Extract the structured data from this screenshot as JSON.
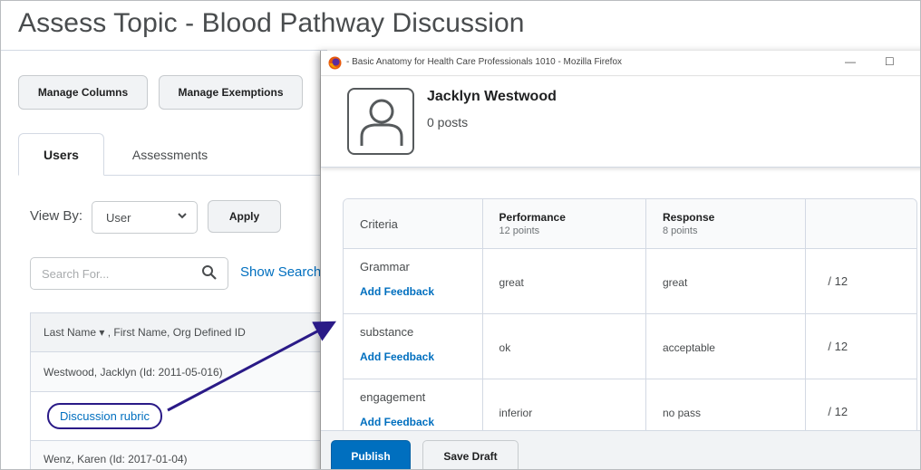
{
  "page": {
    "title": "Assess Topic - Blood Pathway Discussion"
  },
  "toolbar": {
    "manage_columns": "Manage Columns",
    "manage_exemptions": "Manage Exemptions"
  },
  "tabs": [
    {
      "label": "Users",
      "active": true
    },
    {
      "label": "Assessments",
      "active": false
    }
  ],
  "filter": {
    "view_by_label": "View By:",
    "view_by_value": "User",
    "apply_label": "Apply",
    "search_placeholder": "Search For...",
    "show_search_options": "Show Search"
  },
  "grid": {
    "header": "Last Name ▾ , First Name, Org Defined ID",
    "rows": [
      {
        "name": "Westwood, Jacklyn (Id: 2011-05-016)"
      },
      {
        "link": "Discussion rubric"
      },
      {
        "name": "Wenz, Karen (Id: 2017-01-04)"
      }
    ]
  },
  "popup": {
    "window_title": "- Basic Anatomy for Health Care Professionals 1010 - Mozilla Firefox",
    "user_name": "Jacklyn Westwood",
    "posts": "0 posts",
    "rubric": {
      "criteria_header": "Criteria",
      "levels": [
        {
          "name": "Performance",
          "points": "12 points"
        },
        {
          "name": "Response",
          "points": "8 points"
        }
      ],
      "rows": [
        {
          "criterion": "Grammar",
          "feedback": "Add Feedback",
          "performance": "great",
          "response": "great",
          "score": "/ 12"
        },
        {
          "criterion": "substance",
          "feedback": "Add Feedback",
          "performance": "ok",
          "response": "acceptable",
          "score": "/ 12"
        },
        {
          "criterion": "engagement",
          "feedback": "Add Feedback",
          "performance": "inferior",
          "response": "no pass",
          "score": "/ 12"
        }
      ]
    },
    "footer": {
      "publish": "Publish",
      "save_draft": "Save Draft"
    }
  },
  "colors": {
    "link": "#006fbf",
    "primary": "#006fbf",
    "annotation": "#2a1a87"
  }
}
